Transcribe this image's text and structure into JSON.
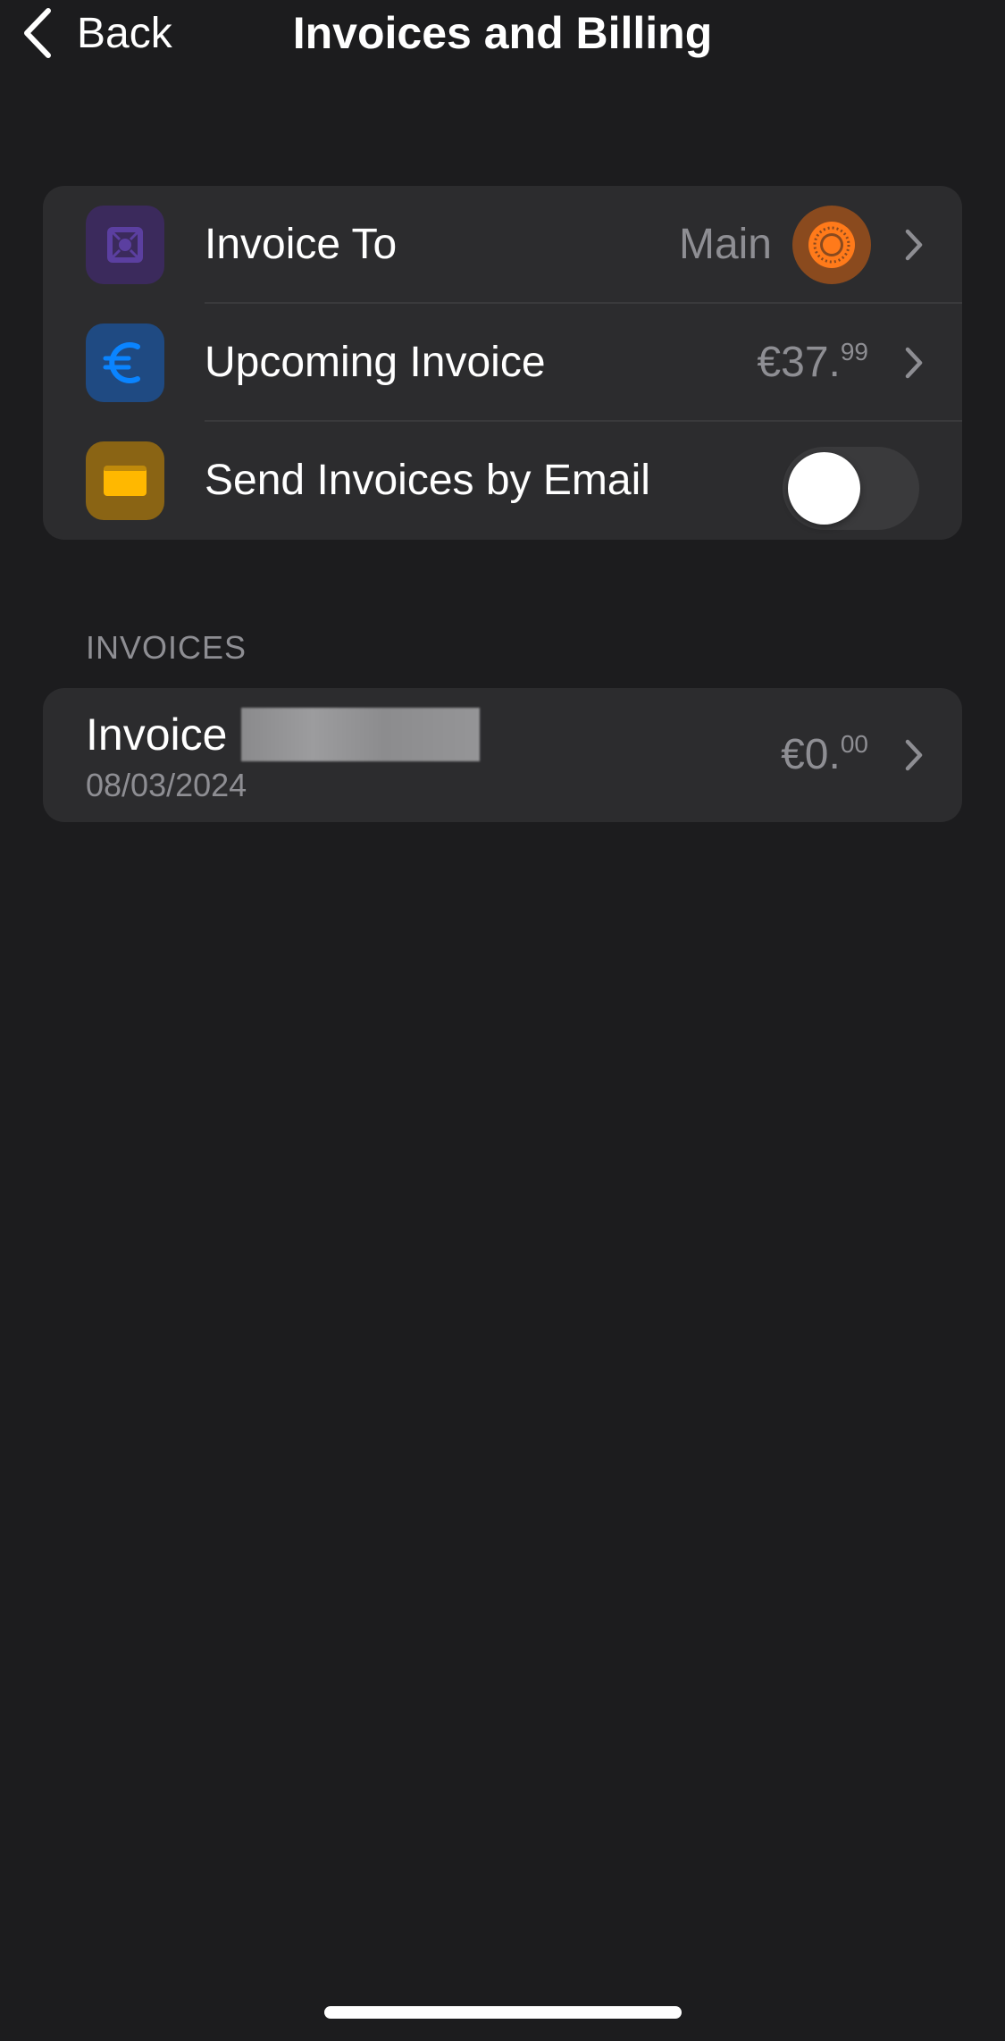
{
  "nav": {
    "back_label": "Back",
    "title": "Invoices and Billing"
  },
  "settings": {
    "invoice_to": {
      "label": "Invoice To",
      "value": "Main",
      "icon": "safe-box-icon",
      "icon_color": "#5b3fa0"
    },
    "upcoming_invoice": {
      "label": "Upcoming Invoice",
      "amount_main": "€37.",
      "amount_cents": "99",
      "icon": "euro-icon",
      "icon_color": "#0a84ff"
    },
    "send_by_email": {
      "label": "Send Invoices by Email",
      "enabled": false,
      "icon": "envelope-icon",
      "icon_color": "#ffb800"
    }
  },
  "invoices": {
    "header": "INVOICES",
    "items": [
      {
        "title": "Invoice",
        "date": "08/03/2024",
        "amount_main": "€0.",
        "amount_cents": "00"
      }
    ]
  },
  "colors": {
    "background": "#1c1c1e",
    "card": "#2c2c2e",
    "secondary_text": "#8e8e93",
    "avatar": "#ff7a1a"
  }
}
